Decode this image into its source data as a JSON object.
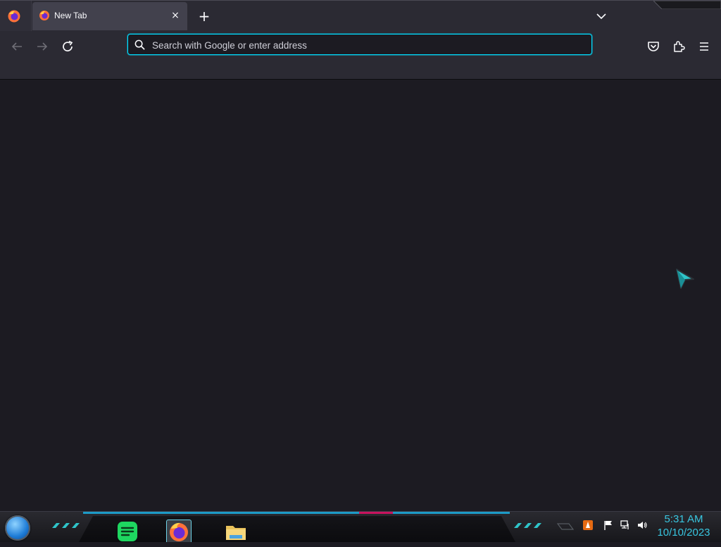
{
  "browser": {
    "tabs": [
      {
        "title": "New Tab",
        "active": true
      }
    ],
    "new_tab_glyph": "+",
    "close_glyph": "×"
  },
  "navbar": {
    "url_placeholder": "Search with Google or enter address",
    "url_value": "",
    "icons": [
      "back-arrow-icon",
      "forward-arrow-icon",
      "reload-icon",
      "search-icon",
      "pocket-icon",
      "extensions-icon",
      "menu-icon"
    ]
  },
  "taskbar": {
    "clock_time": "5:31 AM",
    "clock_date": "10/10/2023",
    "pinned_apps": [
      "spotify-like-green-app",
      "firefox",
      "file-explorer"
    ],
    "tray_icons": [
      "vlc-icon",
      "action-center-flag-icon",
      "network-icon",
      "volume-icon"
    ],
    "accent_color": "#1d9bc7",
    "clock_color": "#38c6e0"
  },
  "colors": {
    "chrome_bg": "#2b2a33",
    "content_bg": "#1c1b22",
    "active_tab_bg": "#42414d",
    "focus_ring": "#00ddff"
  }
}
